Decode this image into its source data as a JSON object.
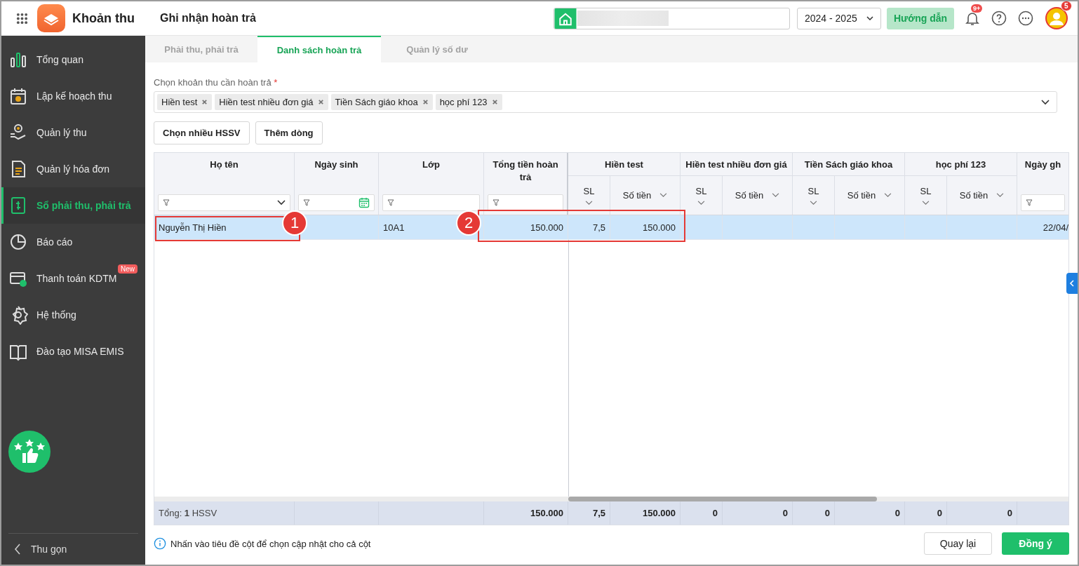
{
  "app": {
    "name": "Khoản thu"
  },
  "page_title": "Ghi nhận hoàn trả",
  "topbar": {
    "year": "2024 - 2025",
    "guide_button": "Hướng dẫn",
    "notification_badge": "9+",
    "avatar_badge": "5"
  },
  "sidebar": {
    "items": [
      {
        "label": "Tổng quan",
        "selected": false
      },
      {
        "label": "Lập kế hoạch thu",
        "selected": false
      },
      {
        "label": "Quản lý thu",
        "selected": false
      },
      {
        "label": "Quản lý hóa đơn",
        "selected": false
      },
      {
        "label": "Sổ phải thu, phải trả",
        "selected": true
      },
      {
        "label": "Báo cáo",
        "selected": false
      },
      {
        "label": "Thanh toán KDTM",
        "selected": false,
        "badge": "New"
      },
      {
        "label": "Hệ thống",
        "selected": false
      },
      {
        "label": "Đào tạo MISA EMIS",
        "selected": false
      }
    ],
    "collapse": "Thu gọn"
  },
  "tabs": [
    {
      "label": "Phải thu, phải trả",
      "selected": false
    },
    {
      "label": "Danh sách hoàn trả",
      "selected": true
    },
    {
      "label": "Quản lý số dư",
      "selected": false
    }
  ],
  "fee_picker": {
    "label": "Chọn khoản thu cần hoàn trả",
    "required_mark": "*",
    "tags": [
      "Hiền test",
      "Hiền test nhiều đơn giá",
      "Tiền Sách giáo khoa",
      "học phí 123"
    ]
  },
  "actions": [
    "Chọn nhiều HSSV",
    "Thêm dòng"
  ],
  "table": {
    "columns": [
      {
        "kind": "single",
        "title": "Họ tên",
        "filter": {
          "kind": "dropdown"
        }
      },
      {
        "kind": "single",
        "title": "Ngày sinh",
        "filter": {
          "kind": "date"
        }
      },
      {
        "kind": "single",
        "title": "Lớp",
        "filter": {
          "kind": "text"
        }
      },
      {
        "kind": "single",
        "title": "Tổng tiền hoàn trả",
        "filter": {
          "kind": "text"
        }
      },
      {
        "kind": "group",
        "title": "Hiền test",
        "subcolumns": [
          "SL",
          "Số tiền"
        ]
      },
      {
        "kind": "group",
        "title": "Hiền test nhiều đơn giá",
        "subcolumns": [
          "SL",
          "Số tiền"
        ]
      },
      {
        "kind": "group",
        "title": "Tiền Sách giáo khoa",
        "subcolumns": [
          "SL",
          "Số tiền"
        ]
      },
      {
        "kind": "group",
        "title": "học phí 123",
        "subcolumns": [
          "SL",
          "Số tiền"
        ]
      },
      {
        "kind": "single",
        "title": "Ngày gh",
        "filter": {
          "kind": "text"
        }
      }
    ],
    "rows": [
      {
        "selected": true,
        "cells": [
          "Nguyễn Thị Hiền",
          null,
          "10A1",
          "150.000",
          "7,5",
          "150.000",
          null,
          null,
          null,
          null,
          null,
          null,
          "22/04/"
        ]
      }
    ],
    "footer": {
      "label": "Tổng: **1** HSSV",
      "values": [
        "150.000",
        "7,5",
        "150.000",
        "0",
        "0",
        "0",
        "0",
        "0",
        "0"
      ]
    }
  },
  "callouts": [
    {
      "number": "1"
    },
    {
      "number": "2"
    }
  ],
  "hint": "Nhấn vào tiêu đề cột để chọn cập nhật cho cả cột",
  "buttons": [
    {
      "label": "Quay lại",
      "kind": "secondary"
    },
    {
      "label": "Đồng ý",
      "kind": "primary"
    }
  ]
}
